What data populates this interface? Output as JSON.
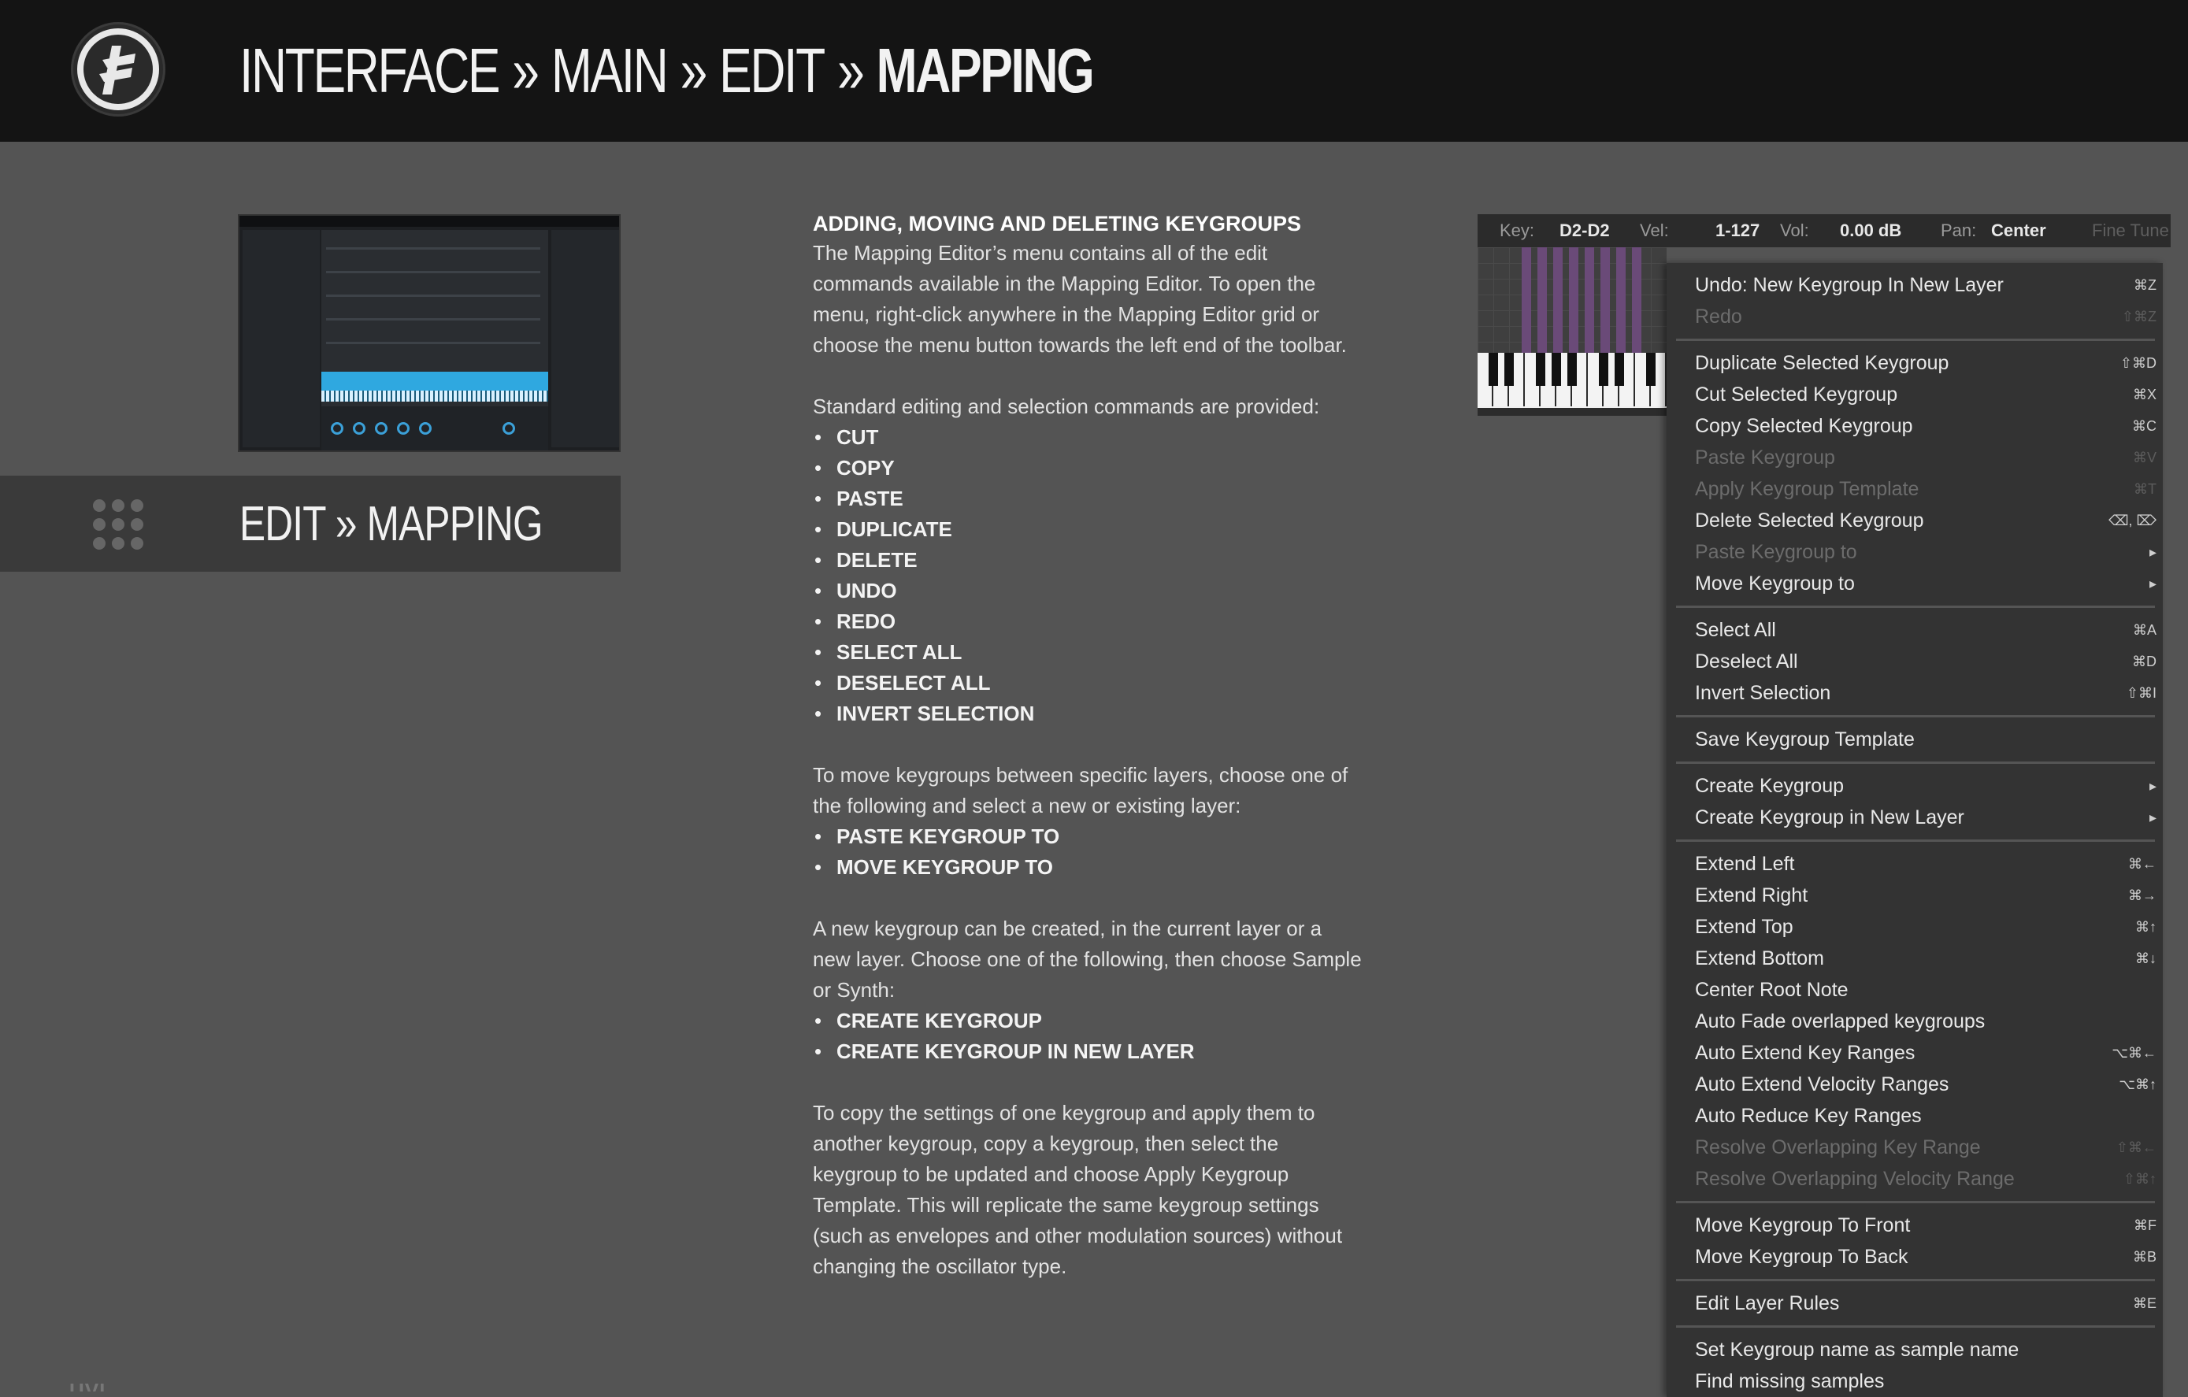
{
  "header": {
    "crumbs": [
      "INTERFACE",
      "MAIN",
      "EDIT"
    ],
    "current": "MAPPING",
    "separator": "»"
  },
  "section": {
    "title": "EDIT » MAPPING"
  },
  "article": {
    "heading": "ADDING, MOVING AND DELETING KEYGROUPS",
    "intro": "The Mapping Editor’s menu contains all of the edit commands available in the Mapping Editor. To open the menu, right-click anywhere in the Mapping Editor grid or choose the menu button towards the left end of the toolbar.",
    "standard_intro": "Standard editing and selection commands are provided:",
    "standard_list": [
      "CUT",
      "COPY",
      "PASTE",
      "DUPLICATE",
      "DELETE",
      "UNDO",
      "REDO",
      "SELECT ALL",
      "DESELECT ALL",
      "INVERT SELECTION"
    ],
    "move_intro": "To move keygroups between specific layers, choose one of the following and select a new or existing layer:",
    "move_list": [
      "PASTE KEYGROUP TO",
      "MOVE KEYGROUP TO"
    ],
    "create_intro": "A new keygroup can be created, in the current layer or a new layer. Choose one of the following, then choose Sample or Synth:",
    "create_list": [
      "CREATE KEYGROUP",
      "CREATE KEYGROUP IN NEW LAYER"
    ],
    "template_text": "To copy the settings of one keygroup and apply them to another keygroup, copy a keygroup, then select the keygroup to be updated and choose Apply Keygroup Template. This will replicate the same keygroup settings (such as envelopes and other modulation sources) without changing the oscillator type."
  },
  "keybar": {
    "key_label": "Key:",
    "key_value": "D2-D2",
    "vel_label": "Vel:",
    "vel_value": "1-127",
    "vol_label": "Vol:",
    "vol_value": "0.00 dB",
    "pan_label": "Pan:",
    "pan_value": "Center",
    "fine_label": "Fine Tune"
  },
  "menu": {
    "items": [
      {
        "label": "Undo: New Keygroup In New Layer",
        "shortcut": "⌘Z",
        "disabled": false
      },
      {
        "label": "Redo",
        "shortcut": "⇧⌘Z",
        "disabled": true
      },
      {
        "label": "Duplicate Selected Keygroup",
        "shortcut": "⇧⌘D",
        "disabled": false
      },
      {
        "label": "Cut Selected Keygroup",
        "shortcut": "⌘X",
        "disabled": false
      },
      {
        "label": "Copy Selected Keygroup",
        "shortcut": "⌘C",
        "disabled": false
      },
      {
        "label": "Paste Keygroup",
        "shortcut": "⌘V",
        "disabled": true
      },
      {
        "label": "Apply Keygroup Template",
        "shortcut": "⌘T",
        "disabled": true
      },
      {
        "label": "Delete Selected Keygroup",
        "shortcut": "⌫, ⌦",
        "disabled": false
      },
      {
        "label": "Paste Keygroup to",
        "shortcut": "▸",
        "disabled": true
      },
      {
        "label": "Move Keygroup to",
        "shortcut": "▸",
        "disabled": false
      },
      {
        "label": "Select All",
        "shortcut": "⌘A",
        "disabled": false
      },
      {
        "label": "Deselect All",
        "shortcut": "⌘D",
        "disabled": false
      },
      {
        "label": "Invert Selection",
        "shortcut": "⇧⌘I",
        "disabled": false
      },
      {
        "label": "Save Keygroup Template",
        "shortcut": "",
        "disabled": false
      },
      {
        "label": "Create Keygroup",
        "shortcut": "▸",
        "disabled": false
      },
      {
        "label": "Create Keygroup in New Layer",
        "shortcut": "▸",
        "disabled": false
      },
      {
        "label": "Extend Left",
        "shortcut": "⌘←",
        "disabled": false
      },
      {
        "label": "Extend Right",
        "shortcut": "⌘→",
        "disabled": false
      },
      {
        "label": "Extend Top",
        "shortcut": "⌘↑",
        "disabled": false
      },
      {
        "label": "Extend Bottom",
        "shortcut": "⌘↓",
        "disabled": false
      },
      {
        "label": "Center Root Note",
        "shortcut": "",
        "disabled": false
      },
      {
        "label": "Auto Fade overlapped keygroups",
        "shortcut": "",
        "disabled": false
      },
      {
        "label": "Auto Extend Key Ranges",
        "shortcut": "⌥⌘←",
        "disabled": false
      },
      {
        "label": "Auto Extend Velocity Ranges",
        "shortcut": "⌥⌘↑",
        "disabled": false
      },
      {
        "label": "Auto Reduce Key Ranges",
        "shortcut": "",
        "disabled": false
      },
      {
        "label": "Resolve Overlapping Key Range",
        "shortcut": "⇧⌘←",
        "disabled": true
      },
      {
        "label": "Resolve Overlapping Velocity Range",
        "shortcut": "⇧⌘↑",
        "disabled": true
      },
      {
        "label": "Move Keygroup To Front",
        "shortcut": "⌘F",
        "disabled": false
      },
      {
        "label": "Move Keygroup To Back",
        "shortcut": "⌘B",
        "disabled": false
      },
      {
        "label": "Edit Layer Rules",
        "shortcut": "⌘E",
        "disabled": false
      },
      {
        "label": "Set Keygroup name as sample name",
        "shortcut": "",
        "disabled": false
      },
      {
        "label": "Find missing samples",
        "shortcut": "",
        "disabled": false
      }
    ]
  },
  "footer": {
    "mark": "UVI"
  },
  "colors": {
    "header_bg": "#141414",
    "page_bg": "#545454",
    "section_bg": "#3a3a3a",
    "menu_bg": "#333333",
    "accent_blue": "#2fa8e0",
    "key_red": "#e0301e"
  }
}
